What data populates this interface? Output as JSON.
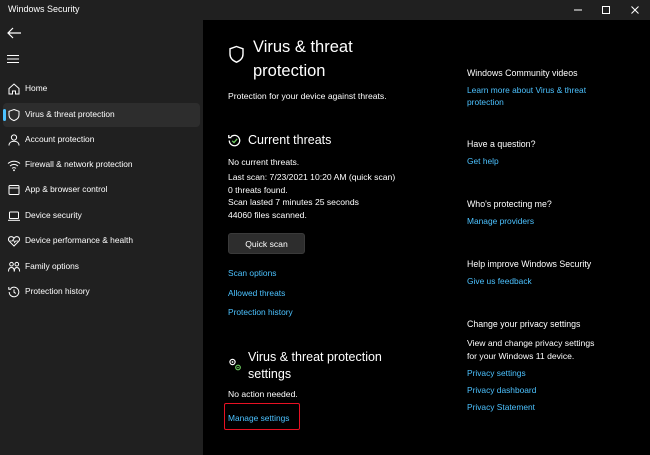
{
  "window": {
    "title": "Windows Security",
    "controls": [
      "minimize-icon",
      "maximize-icon",
      "close-icon"
    ]
  },
  "sidebar": {
    "items": [
      {
        "label": "Home",
        "icon": "home-icon",
        "active": false
      },
      {
        "label": "Virus & threat protection",
        "icon": "shield-icon",
        "active": true
      },
      {
        "label": "Account protection",
        "icon": "person-icon",
        "active": false
      },
      {
        "label": "Firewall & network protection",
        "icon": "wifi-icon",
        "active": false
      },
      {
        "label": "App & browser control",
        "icon": "app-window-icon",
        "active": false
      },
      {
        "label": "Device security",
        "icon": "laptop-icon",
        "active": false
      },
      {
        "label": "Device performance & health",
        "icon": "heart-icon",
        "active": false
      },
      {
        "label": "Family options",
        "icon": "family-icon",
        "active": false
      },
      {
        "label": "Protection history",
        "icon": "history-icon",
        "active": false
      }
    ]
  },
  "page": {
    "title_line1": "Virus & threat",
    "title_line2": "protection",
    "subtitle": "Protection for your device against threats."
  },
  "current_threats": {
    "heading": "Current threats",
    "status": "No current threats.",
    "last_scan": "Last scan: 7/23/2021 10:20 AM (quick scan)",
    "threats_found": "0 threats found.",
    "scan_duration": "Scan lasted 7 minutes 25 seconds",
    "files_scanned": "44060 files scanned.",
    "quick_scan_label": "Quick scan",
    "links": [
      "Scan options",
      "Allowed threats",
      "Protection history"
    ]
  },
  "settings": {
    "heading_line1": "Virus & threat protection",
    "heading_line2": "settings",
    "status": "No action needed.",
    "manage_link": "Manage settings"
  },
  "right_panel": {
    "community": {
      "heading": "Windows Community videos",
      "link_line1": "Learn more about Virus & threat",
      "link_line2": "protection"
    },
    "question": {
      "heading": "Have a question?",
      "link": "Get help"
    },
    "protecting": {
      "heading": "Who's protecting me?",
      "link": "Manage providers"
    },
    "improve": {
      "heading": "Help improve Windows Security",
      "link": "Give us feedback"
    },
    "privacy": {
      "heading": "Change your privacy settings",
      "text_line1": "View and change privacy settings",
      "text_line2": "for your Windows 11 device.",
      "links": [
        "Privacy settings",
        "Privacy dashboard",
        "Privacy Statement"
      ]
    }
  },
  "colors": {
    "accent": "#4cc2ff",
    "highlight_box": "#e81123",
    "sidebar_bg": "#202020",
    "main_bg": "#000000"
  }
}
